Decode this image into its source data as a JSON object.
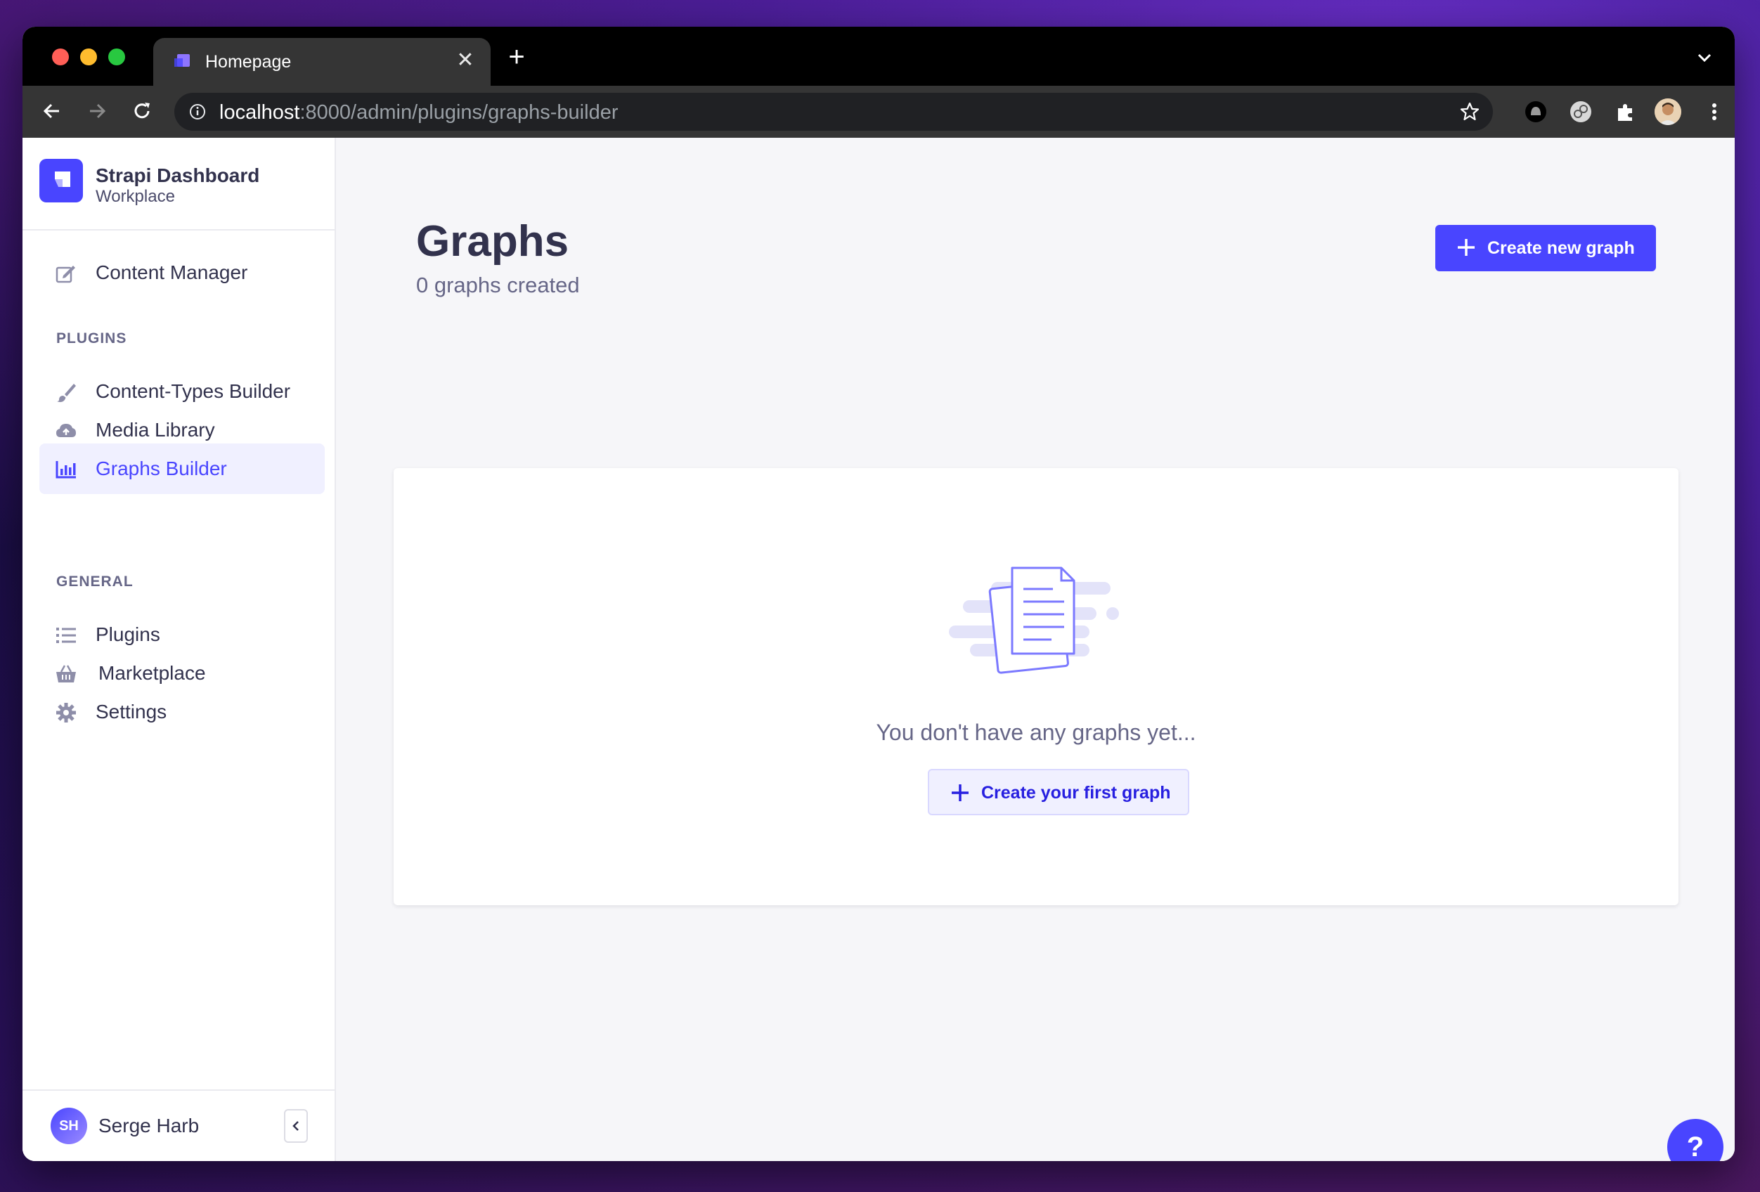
{
  "browser": {
    "tab_title": "Homepage",
    "url_host": "localhost",
    "url_rest": ":8000/admin/plugins/graphs-builder"
  },
  "sidebar": {
    "brand_title": "Strapi Dashboard",
    "brand_subtitle": "Workplace",
    "items": [
      {
        "label": "Content Manager",
        "icon": "edit-icon"
      },
      {
        "label": "Content-Types Builder",
        "icon": "paintbrush-icon"
      },
      {
        "label": "Media Library",
        "icon": "cloud-upload-icon"
      },
      {
        "label": "Graphs Builder",
        "icon": "bar-chart-icon",
        "active": true
      },
      {
        "label": "Plugins",
        "icon": "list-icon"
      },
      {
        "label": "Marketplace",
        "icon": "basket-icon"
      },
      {
        "label": "Settings",
        "icon": "gear-icon"
      }
    ],
    "section_plugins": "PLUGINS",
    "section_general": "GENERAL",
    "user_initials": "SH",
    "user_name": "Serge Harb"
  },
  "main": {
    "title": "Graphs",
    "subtitle": "0 graphs created",
    "create_button": "Create new graph",
    "empty_text": "You don't have any graphs yet...",
    "empty_button": "Create your first graph",
    "help_label": "?"
  },
  "colors": {
    "accent": "#4945ff",
    "accent_light": "#f0f0ff",
    "text_primary": "#32324d",
    "text_secondary": "#666687"
  }
}
